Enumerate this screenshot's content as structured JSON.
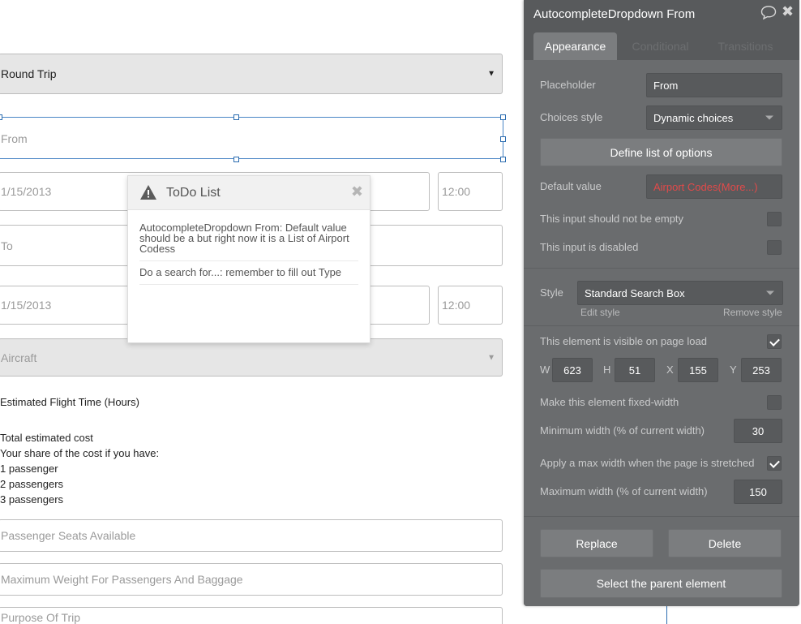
{
  "form": {
    "trip_type": "Round Trip",
    "from_placeholder": "From",
    "depart_date": "1/15/2013",
    "depart_time": "12:00",
    "to_placeholder": "To",
    "return_date": "1/15/2013",
    "return_time": "12:00",
    "aircraft_placeholder": "Aircraft",
    "estimated_flight_time": "Estimated Flight Time (Hours)",
    "total_estimated_cost": "Total estimated cost",
    "share_of_cost": "Your share of the cost if you have:",
    "passenger_options": [
      "1 passenger",
      "2 passengers",
      "3 passengers"
    ],
    "seats_placeholder": "Passenger Seats Available",
    "weight_placeholder": "Maximum Weight For Passengers And Baggage",
    "purpose_placeholder": "Purpose Of Trip"
  },
  "todo": {
    "title": "ToDo List",
    "icon": "warning-icon",
    "items": [
      "AutocompleteDropdown From: Default value should be a but right now it is a List of Airport Codess",
      "Do a search for...: remember to fill out Type"
    ]
  },
  "editor": {
    "title": "AutocompleteDropdown From",
    "tabs": [
      "Appearance",
      "Conditional",
      "Transitions"
    ],
    "active_tab": "Appearance",
    "placeholder_label": "Placeholder",
    "placeholder_value": "From",
    "choices_style_label": "Choices style",
    "choices_style_value": "Dynamic choices",
    "define_options_button": "Define list of options",
    "default_value_label": "Default value",
    "default_value_value": "Airport Codes(More...)",
    "not_empty_label": "This input should not be empty",
    "not_empty_checked": false,
    "disabled_label": "This input is disabled",
    "disabled_checked": false,
    "style_label": "Style",
    "style_value": "Standard Search Box",
    "edit_style_link": "Edit style",
    "remove_style_link": "Remove style",
    "visible_label": "This element is visible on page load",
    "visible_checked": true,
    "w_label": "W",
    "w_value": "623",
    "h_label": "H",
    "h_value": "51",
    "x_label": "X",
    "x_value": "155",
    "y_label": "Y",
    "y_value": "253",
    "fixed_width_label": "Make this element fixed-width",
    "fixed_width_checked": false,
    "min_width_label": "Minimum width (% of current width)",
    "min_width_value": "30",
    "max_width_apply_label": "Apply a max width when the page is stretched",
    "max_width_apply_checked": true,
    "max_width_label": "Maximum width (% of current width)",
    "max_width_value": "150",
    "replace_button": "Replace",
    "delete_button": "Delete",
    "select_parent_button": "Select the parent element"
  },
  "colors": {
    "panel_bg": "#585a5c",
    "panel_body_bg": "#6a6c6e",
    "selection_outline": "#4a86c5",
    "default_value_text": "#e14a4a"
  }
}
